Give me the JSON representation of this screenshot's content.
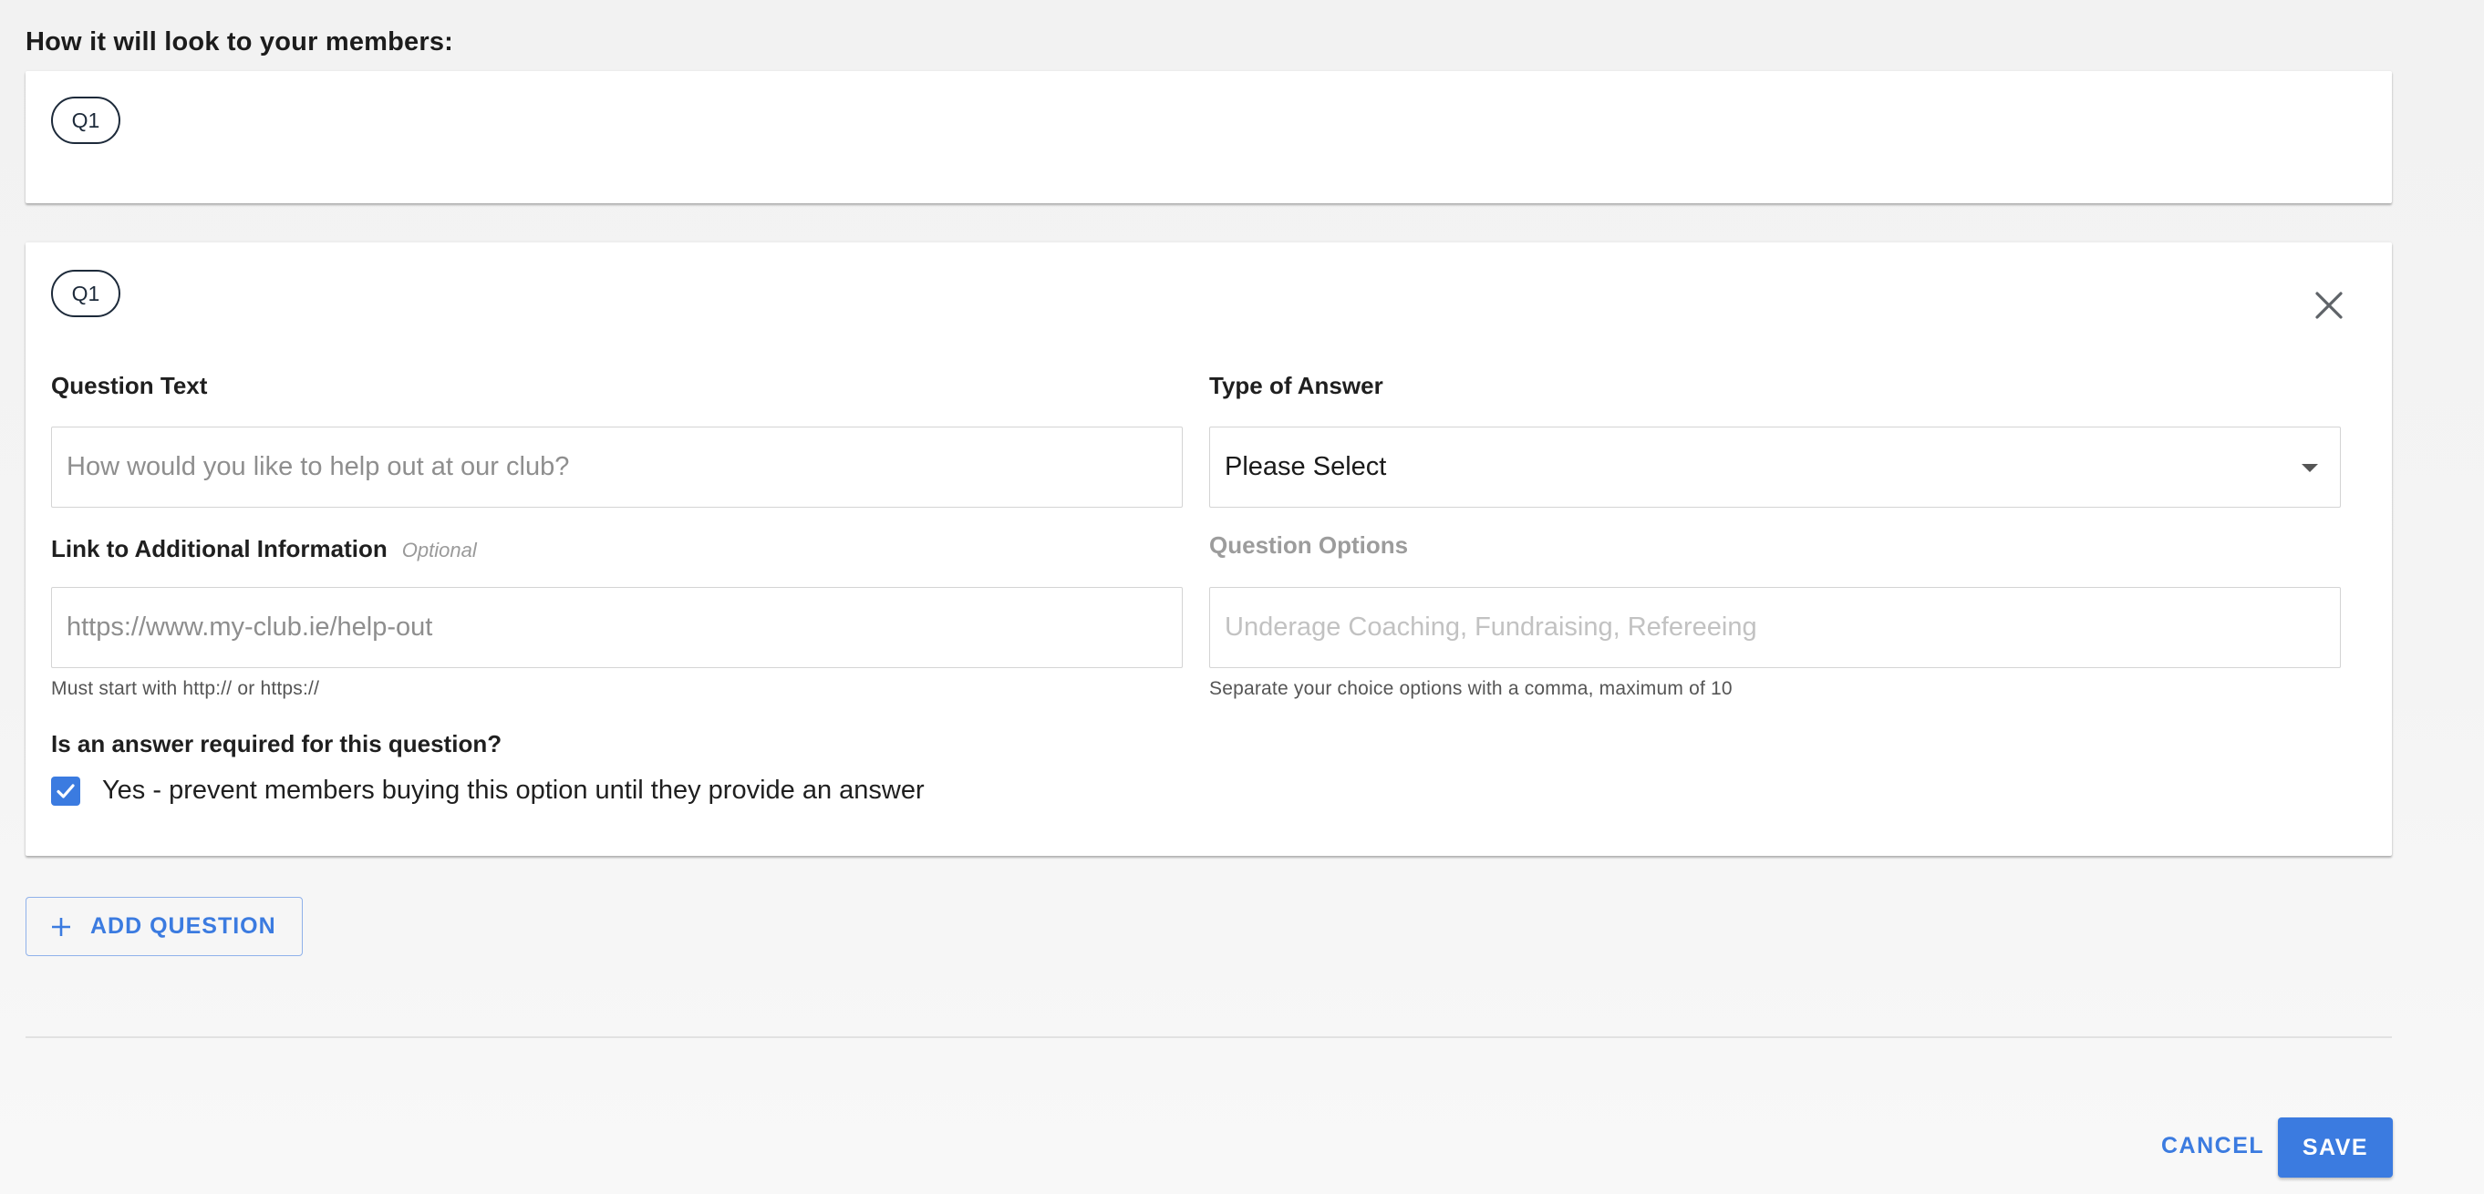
{
  "preview": {
    "title": "How it will look to your members:",
    "question_chip": "Q1"
  },
  "editor": {
    "question_chip": "Q1",
    "close_icon": "close-icon",
    "question_text": {
      "label": "Question Text",
      "placeholder": "How would you like to help out at our club?",
      "value": ""
    },
    "type_of_answer": {
      "label": "Type of Answer",
      "selected": "Please Select"
    },
    "link": {
      "label": "Link to Additional Information",
      "optional": "Optional",
      "placeholder": "https://www.my-club.ie/help-out",
      "value": "",
      "helper": "Must start with http:// or https://"
    },
    "question_options": {
      "label": "Question Options",
      "placeholder": "Underage Coaching, Fundraising, Refereeing",
      "value": "",
      "helper": "Separate your choice options with a comma, maximum of 10"
    },
    "required": {
      "label": "Is an answer required for this question?",
      "checkbox_label": "Yes - prevent members buying this option until they provide an answer",
      "checked": true
    }
  },
  "add_question_label": "ADD QUESTION",
  "footer": {
    "cancel_label": "CANCEL",
    "save_label": "SAVE"
  },
  "colors": {
    "accent": "#3b7be0",
    "chip_border": "#1d2a3a"
  }
}
